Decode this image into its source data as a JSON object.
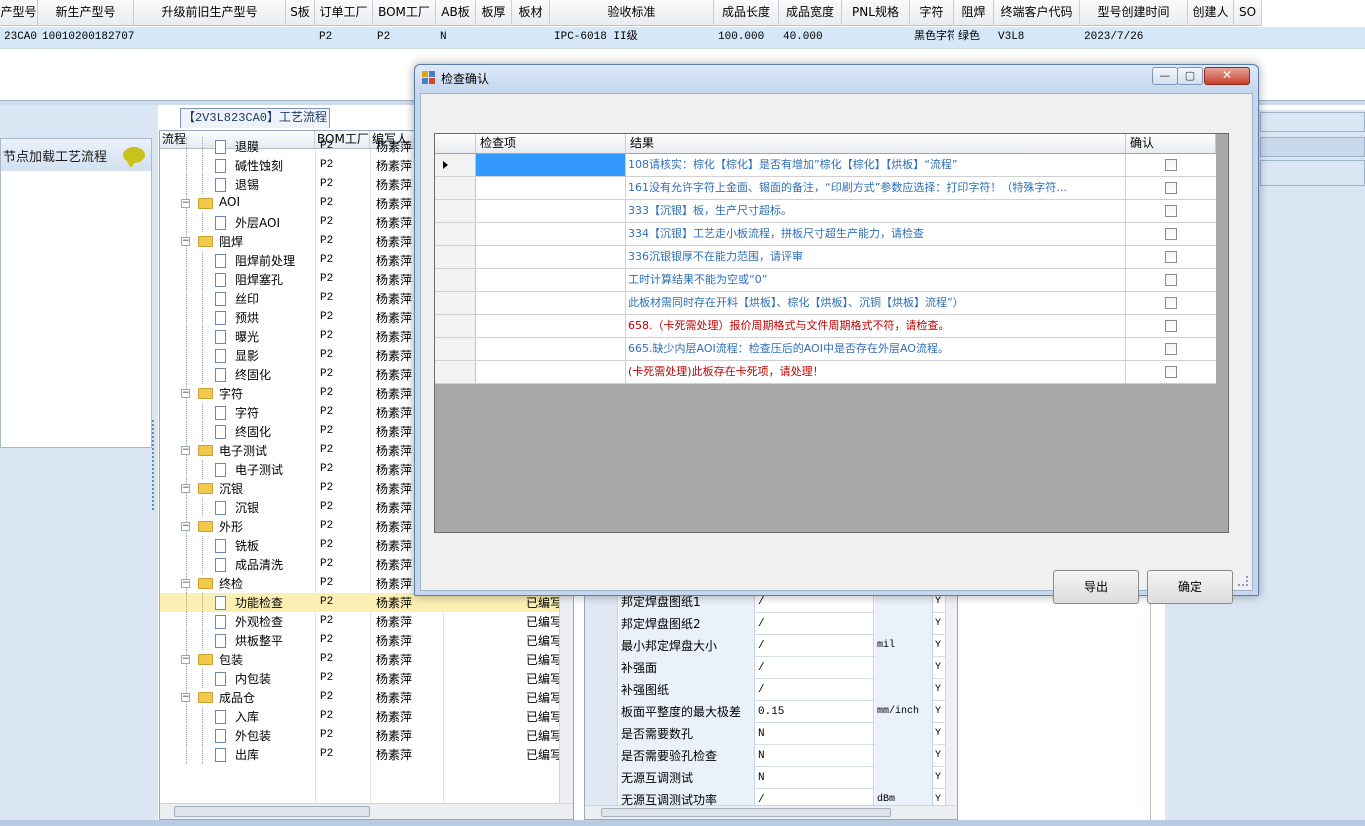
{
  "top_grid": {
    "headers": [
      "产型号",
      "新生产型号",
      "升级前旧生产型号",
      "S板",
      "订单工厂",
      "BOM工厂",
      "AB板",
      "板厚",
      "板材",
      "验收标准",
      "成品长度",
      "成品宽度",
      "PNL规格",
      "字符",
      "阻焊",
      "终端客户代码",
      "型号创建时间",
      "创建人",
      "SO"
    ],
    "row": [
      "23CA0",
      "10010200182707",
      "",
      "",
      "P2",
      "P2",
      "N",
      "",
      "",
      "IPC-6018 II级",
      "100.000",
      "40.000",
      "",
      "黑色字符",
      "绿色",
      "V3L8",
      "2023/7/26",
      "",
      ""
    ]
  },
  "left_panel": {
    "tab_label": "【2V3L823CA0】工艺流程",
    "sub_title": "节点加载工艺流程"
  },
  "tree": {
    "columns": [
      "流程",
      "BOM工厂",
      "编写人"
    ],
    "rows": [
      {
        "name": "退膜",
        "level": 1,
        "folder": false,
        "bom": "P2",
        "writer": "杨素萍",
        "status": ""
      },
      {
        "name": "碱性蚀刻",
        "level": 1,
        "folder": false,
        "bom": "P2",
        "writer": "杨素萍",
        "status": ""
      },
      {
        "name": "退锡",
        "level": 1,
        "folder": false,
        "bom": "P2",
        "writer": "杨素萍",
        "status": ""
      },
      {
        "name": "AOI",
        "level": 0,
        "folder": true,
        "bom": "P2",
        "writer": "杨素萍",
        "status": ""
      },
      {
        "name": "外层AOI",
        "level": 1,
        "folder": false,
        "bom": "P2",
        "writer": "杨素萍",
        "status": ""
      },
      {
        "name": "阻焊",
        "level": 0,
        "folder": true,
        "bom": "P2",
        "writer": "杨素萍",
        "status": ""
      },
      {
        "name": "阻焊前处理",
        "level": 1,
        "folder": false,
        "bom": "P2",
        "writer": "杨素萍",
        "status": ""
      },
      {
        "name": "阻焊塞孔",
        "level": 1,
        "folder": false,
        "bom": "P2",
        "writer": "杨素萍",
        "status": ""
      },
      {
        "name": "丝印",
        "level": 1,
        "folder": false,
        "bom": "P2",
        "writer": "杨素萍",
        "status": ""
      },
      {
        "name": "预烘",
        "level": 1,
        "folder": false,
        "bom": "P2",
        "writer": "杨素萍",
        "status": ""
      },
      {
        "name": "曝光",
        "level": 1,
        "folder": false,
        "bom": "P2",
        "writer": "杨素萍",
        "status": ""
      },
      {
        "name": "显影",
        "level": 1,
        "folder": false,
        "bom": "P2",
        "writer": "杨素萍",
        "status": ""
      },
      {
        "name": "终固化",
        "level": 1,
        "folder": false,
        "bom": "P2",
        "writer": "杨素萍",
        "status": ""
      },
      {
        "name": "字符",
        "level": 0,
        "folder": true,
        "bom": "P2",
        "writer": "杨素萍",
        "status": ""
      },
      {
        "name": "字符",
        "level": 1,
        "folder": false,
        "bom": "P2",
        "writer": "杨素萍",
        "status": ""
      },
      {
        "name": "终固化",
        "level": 1,
        "folder": false,
        "bom": "P2",
        "writer": "杨素萍",
        "status": ""
      },
      {
        "name": "电子测试",
        "level": 0,
        "folder": true,
        "bom": "P2",
        "writer": "杨素萍",
        "status": ""
      },
      {
        "name": "电子测试",
        "level": 1,
        "folder": false,
        "bom": "P2",
        "writer": "杨素萍",
        "status": ""
      },
      {
        "name": "沉银",
        "level": 0,
        "folder": true,
        "bom": "P2",
        "writer": "杨素萍",
        "status": ""
      },
      {
        "name": "沉银",
        "level": 1,
        "folder": false,
        "bom": "P2",
        "writer": "杨素萍",
        "status": ""
      },
      {
        "name": "外形",
        "level": 0,
        "folder": true,
        "bom": "P2",
        "writer": "杨素萍",
        "status": ""
      },
      {
        "name": "铣板",
        "level": 1,
        "folder": false,
        "bom": "P2",
        "writer": "杨素萍",
        "status": ""
      },
      {
        "name": "成品清洗",
        "level": 1,
        "folder": false,
        "bom": "P2",
        "writer": "杨素萍",
        "status": ""
      },
      {
        "name": "终检",
        "level": 0,
        "folder": true,
        "bom": "P2",
        "writer": "杨素萍",
        "status": ""
      },
      {
        "name": "功能检查",
        "level": 1,
        "folder": false,
        "bom": "P2",
        "writer": "杨素萍",
        "status": "已编写",
        "selected": true
      },
      {
        "name": "外观检查",
        "level": 1,
        "folder": false,
        "bom": "P2",
        "writer": "杨素萍",
        "status": "已编写"
      },
      {
        "name": "烘板整平",
        "level": 1,
        "folder": false,
        "bom": "P2",
        "writer": "杨素萍",
        "status": "已编写"
      },
      {
        "name": "包装",
        "level": 0,
        "folder": true,
        "bom": "P2",
        "writer": "杨素萍",
        "status": "已编写"
      },
      {
        "name": "内包装",
        "level": 1,
        "folder": false,
        "bom": "P2",
        "writer": "杨素萍",
        "status": "已编写"
      },
      {
        "name": "成品仓",
        "level": 0,
        "folder": true,
        "bom": "P2",
        "writer": "杨素萍",
        "status": "已编写"
      },
      {
        "name": "入库",
        "level": 1,
        "folder": false,
        "bom": "P2",
        "writer": "杨素萍",
        "status": "已编写"
      },
      {
        "name": "外包装",
        "level": 1,
        "folder": false,
        "bom": "P2",
        "writer": "杨素萍",
        "status": "已编写"
      },
      {
        "name": "出库",
        "level": 1,
        "folder": false,
        "bom": "P2",
        "writer": "杨素萍",
        "status": "已编写"
      }
    ]
  },
  "props": {
    "rows": [
      {
        "label": "邦定焊盘图纸1",
        "value": "/",
        "unit": "",
        "yn": "Y"
      },
      {
        "label": "邦定焊盘图纸2",
        "value": "/",
        "unit": "",
        "yn": "Y"
      },
      {
        "label": "最小邦定焊盘大小",
        "value": "/",
        "unit": "mil",
        "yn": "Y"
      },
      {
        "label": "补强面",
        "value": "/",
        "unit": "",
        "yn": "Y"
      },
      {
        "label": "补强图纸",
        "value": "/",
        "unit": "",
        "yn": "Y"
      },
      {
        "label": "板面平整度的最大极差",
        "value": "0.15",
        "unit": "mm/inch",
        "yn": "Y"
      },
      {
        "label": "是否需要数孔",
        "value": "N",
        "unit": "",
        "yn": "Y"
      },
      {
        "label": "是否需要验孔检查",
        "value": "N",
        "unit": "",
        "yn": "Y"
      },
      {
        "label": "无源互调测试",
        "value": "N",
        "unit": "",
        "yn": "Y"
      },
      {
        "label": "无源互调测试功率",
        "value": "/",
        "unit": "dBm",
        "yn": "Y"
      }
    ]
  },
  "dialog": {
    "title": "检查确认",
    "min_label": "—",
    "max_label": "▢",
    "close_label": "✕",
    "columns": [
      "检查项",
      "结果",
      "确认"
    ],
    "rows": [
      {
        "item": "",
        "result": "108请核实：棕化【棕化】是否有增加”棕化【棕化】【烘板】“流程”",
        "critical": false,
        "checked": false,
        "selected": true
      },
      {
        "item": "",
        "result": "161没有允许字符上金面、锡面的备注，“印刷方式”参数应选择：打印字符！（特殊字符...",
        "critical": false,
        "checked": false
      },
      {
        "item": "",
        "result": "333【沉银】板，生产尺寸超标。",
        "critical": false,
        "checked": false
      },
      {
        "item": "",
        "result": "334【沉银】工艺走小板流程，拼板尺寸超生产能力，请检查",
        "critical": false,
        "checked": false
      },
      {
        "item": "",
        "result": "336沉银银厚不在能力范围，请评审",
        "critical": false,
        "checked": false
      },
      {
        "item": "",
        "result": "工时计算结果不能为空或“0”",
        "critical": false,
        "checked": false
      },
      {
        "item": "",
        "result": "此板材需同时存在开料【烘板】、棕化【烘板】、沉铜【烘板】流程”）",
        "critical": false,
        "checked": false
      },
      {
        "item": "",
        "result": "658.（卡死需处理）报价周期格式与文件周期格式不符，请检查。",
        "critical": true,
        "checked": false
      },
      {
        "item": "",
        "result": "665.缺少内层AOI流程：检查压后的AOI中是否存在外层AO流程。",
        "critical": false,
        "checked": false
      },
      {
        "item": "",
        "result": "(卡死需处理)此板存在卡死项，请处理！",
        "critical": true,
        "checked": false
      }
    ],
    "export_label": "导出",
    "ok_label": "确定"
  },
  "colors": {
    "selection_blue": "#3399ff",
    "result_blue": "#2e6fb8",
    "critical_red": "#c00000",
    "tree_selected": "#fcefb4",
    "title_bar": "#c5d8ef"
  }
}
